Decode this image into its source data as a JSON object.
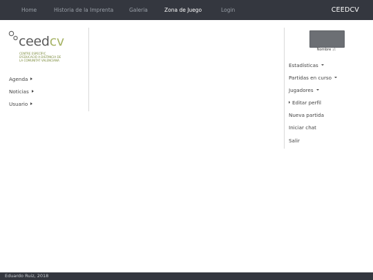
{
  "nav": {
    "items": [
      {
        "label": "Home"
      },
      {
        "label": "Historia de la Imprenta"
      },
      {
        "label": "Galeria"
      },
      {
        "label": "Zona de Juego"
      },
      {
        "label": "Login"
      }
    ],
    "brand": "CEEDCV"
  },
  "logo": {
    "word_main": "ceed",
    "word_accent": "cv",
    "subtitle_lines": [
      "CENTRE ESPECÍFIC",
      "D'EDUCACIÓ A DISTÀNCIA DE",
      "LA COMUNITAT VALENCIANA"
    ],
    "colors": {
      "text": "#5a5a5a",
      "accent": "#a6b365"
    }
  },
  "left_menu": {
    "items": [
      {
        "label": "Agenda"
      },
      {
        "label": "Noticias"
      },
      {
        "label": "Usuario"
      }
    ]
  },
  "profile": {
    "name": "Nombre :/:"
  },
  "right_menu": {
    "items": [
      {
        "label": "Estadísticas"
      },
      {
        "label": "Partidas en curso"
      },
      {
        "label": "Jugadores"
      },
      {
        "label": "Editar perfil"
      },
      {
        "label": "Nueva partida"
      },
      {
        "label": "Iniciar chat"
      },
      {
        "label": "Salir"
      }
    ]
  },
  "footer": {
    "text": "Eduardo Ruiz, 2018"
  },
  "colors": {
    "navbar_bg": "#34373f",
    "nav_text": "#9aa0a8",
    "nav_active": "#ffffff"
  }
}
